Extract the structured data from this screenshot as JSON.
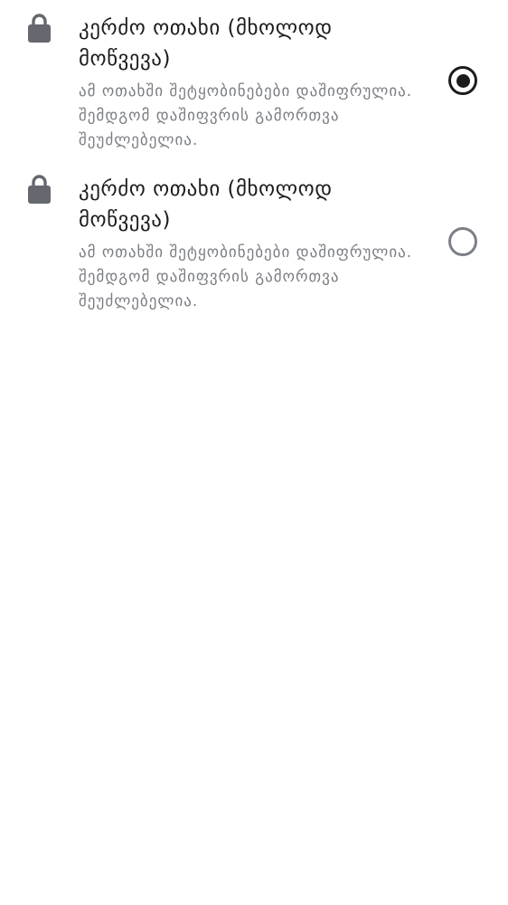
{
  "options": [
    {
      "title": "კერძო ოთახი (მხოლოდ მოწვევა)",
      "description": "ამ ოთახში შეტყობინებები დაშიფრულია. შემდგომ დაშიფვრის გამორთვა შეუძლებელია.",
      "selected": true
    },
    {
      "title": "კერძო ოთახი (მხოლოდ მოწვევა)",
      "description": "ამ ოთახში შეტყობინებები დაშიფრულია. შემდგომ დაშიფვრის გამორთვა შეუძლებელია.",
      "selected": false
    }
  ],
  "colors": {
    "text_primary": "#1d1d1f",
    "text_secondary": "#7a7d82",
    "icon": "#65686e",
    "radio_checked": "#1b1c1e",
    "radio_unchecked": "#7b7f86"
  },
  "icons": {
    "lock": "lock-icon"
  }
}
